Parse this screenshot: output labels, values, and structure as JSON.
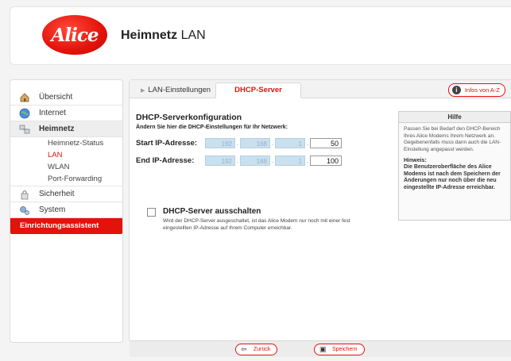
{
  "header": {
    "brand": "Alice",
    "title_bold": "Heimnetz",
    "title_rest": " LAN"
  },
  "sidebar": {
    "items": [
      {
        "label": "Übersicht",
        "icon": "house-icon"
      },
      {
        "label": "Internet",
        "icon": "globe-icon"
      },
      {
        "label": "Heimnetz",
        "icon": "network-icon"
      }
    ],
    "subitems": [
      "Heimnetz-Status",
      "LAN",
      "WLAN",
      "Port-Forwarding"
    ],
    "items2": [
      {
        "label": "Sicherheit",
        "icon": "lock-icon"
      },
      {
        "label": "System",
        "icon": "gears-icon"
      }
    ],
    "wizard": "Einrichtungsassistent"
  },
  "tabs": {
    "lan": "LAN-Einstellungen",
    "dhcp": "DHCP-Server",
    "infos": "Infos von A-Z",
    "infos_glyph": "i"
  },
  "form": {
    "section_title": "DHCP-Serverkonfiguration",
    "instructions": "Ändern Sie hier die DHCP-Einstellungen für Ihr Netzwerk:",
    "start_label": "Start IP-Adresse:",
    "start": [
      "192",
      "168",
      "1",
      "50"
    ],
    "end_label": "End IP-Adresse:",
    "end": [
      "192",
      "168",
      "1",
      "100"
    ],
    "octet_sep": ".",
    "dhcp_off_label": "DHCP-Server ausschalten",
    "dhcp_off_desc": "Wird der DHCP-Server ausgeschaltet, ist das Alice Modem nur noch mit einer fest eingestellten IP-Adresse auf Ihrem Computer erreichbar."
  },
  "help": {
    "title": "Hilfe",
    "text": "Passen Sie bei Bedarf den DHCP-Bereich Ihres Alice Modems Ihrem Netzwerk an. Gegebenenfalls muss dann auch die LAN-Einstellung angepasst werden.",
    "note_heading": "Hinweis:",
    "note": "Die Benutzeroberfläche des Alice Modems ist nach dem Speichern der Änderungen nur noch über die neu eingestellte IP-Adresse erreichbar."
  },
  "footer": {
    "back": "Zurück",
    "save": "Speichern"
  },
  "colors": {
    "brand_red": "#e3120b",
    "field_blue": "#c8e0f0"
  }
}
